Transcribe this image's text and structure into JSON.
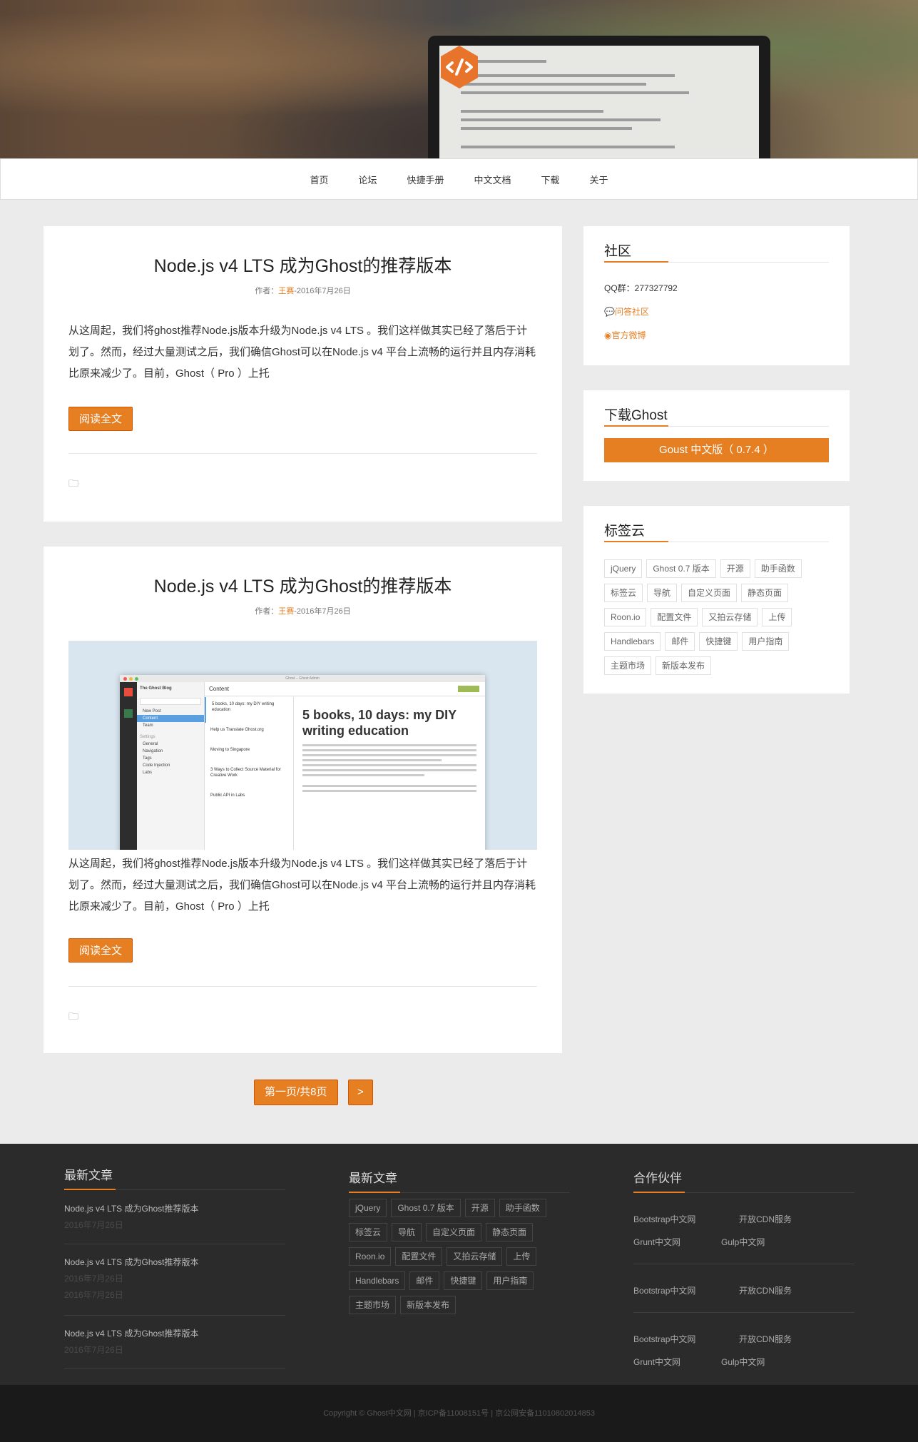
{
  "nav": {
    "items": [
      "首页",
      "论坛",
      "快捷手册",
      "中文文档",
      "下载",
      "关于"
    ]
  },
  "posts": [
    {
      "title": "Node.js v4 LTS 成为Ghost的推荐版本",
      "author_prefix": "作者：",
      "author": "王赛",
      "date": "-2016年7月26日",
      "excerpt": "从这周起，我们将ghost推荐Node.js版本升级为Node.js v4 LTS 。我们这样做其实已经了落后于计划了。然而，经过大量测试之后，我们确信Ghost可以在Node.js v4 平台上流畅的运行并且内存消耗比原来减少了。目前，Ghost（ Pro ）上托",
      "read_more": "阅读全文"
    },
    {
      "title": "Node.js v4 LTS 成为Ghost的推荐版本",
      "author_prefix": "作者：",
      "author": "王赛",
      "date": "-2016年7月26日",
      "excerpt": "从这周起，我们将ghost推荐Node.js版本升级为Node.js v4 LTS 。我们这样做其实已经了落后于计划了。然而，经过大量测试之后，我们确信Ghost可以在Node.js v4 平台上流畅的运行并且内存消耗比原来减少了。目前，Ghost（ Pro ）上托",
      "read_more": "阅读全文",
      "image": {
        "blog_name": "The Ghost Blog",
        "sidebar_items": [
          "New Post",
          "Content",
          "Team",
          "Settings",
          "General",
          "Navigation",
          "Tags",
          "Code Injection",
          "Labs"
        ],
        "content_label": "Content",
        "list": [
          "5 books, 10 days: my DIY writing education",
          "Help us Translate Ghost.org",
          "Moving to Singapore",
          "3 Ways to Collect Source Material for Creative Work",
          "Public API in Labs"
        ],
        "headline": "5 books, 10 days: my DIY writing education",
        "window_title": "Ghost – Ghost Admin"
      }
    }
  ],
  "pagination": {
    "current": "第一页/共8页",
    "next": ">"
  },
  "sidebar": {
    "community": {
      "title": "社区",
      "qq": "QQ群：277327792",
      "forum": "问答社区",
      "weibo": "官方微博"
    },
    "download": {
      "title": "下载Ghost",
      "button": "Goust 中文版（ 0.7.4 ）"
    },
    "tags": {
      "title": "标签云",
      "items": [
        "jQuery",
        "Ghost 0.7 版本",
        "开源",
        "助手函数",
        "标签云",
        "导航",
        "自定义页面",
        "静态页面",
        "Roon.io",
        "配置文件",
        "又拍云存储",
        "上传",
        "Handlebars",
        "邮件",
        "快捷键",
        "用户指南",
        "主题市场",
        "新版本发布"
      ]
    }
  },
  "footer": {
    "latest": {
      "title": "最新文章",
      "articles": [
        {
          "title": "Node.js v4 LTS 成为Ghost推荐版本",
          "dates": [
            "2016年7月26日"
          ]
        },
        {
          "title": "Node.js v4 LTS 成为Ghost推荐版本",
          "dates": [
            "2016年7月26日",
            "2016年7月26日"
          ]
        },
        {
          "title": "Node.js v4 LTS 成为Ghost推荐版本",
          "dates": [
            "2016年7月26日"
          ]
        }
      ]
    },
    "tags": {
      "title": "最新文章",
      "items": [
        "jQuery",
        "Ghost 0.7 版本",
        "开源",
        "助手函数",
        "标签云",
        "导航",
        "自定义页面",
        "静态页面",
        "Roon.io",
        "配置文件",
        "又拍云存储",
        "上传",
        "Handlebars",
        "邮件",
        "快捷键",
        "用户指南",
        "主题市场",
        "新版本发布"
      ]
    },
    "partners": {
      "title": "合作伙伴",
      "groups": [
        [
          "Bootstrap中文网",
          "开放CDN服务",
          "Grunt中文网",
          "Gulp中文网"
        ],
        [
          "Bootstrap中文网",
          "开放CDN服务"
        ],
        [
          "Bootstrap中文网",
          "开放CDN服务",
          "Grunt中文网",
          "Gulp中文网"
        ]
      ]
    },
    "copyright": "Copyright © Ghost中文网 | 京ICP备11008151号 | 京公网安备11010802014853"
  }
}
